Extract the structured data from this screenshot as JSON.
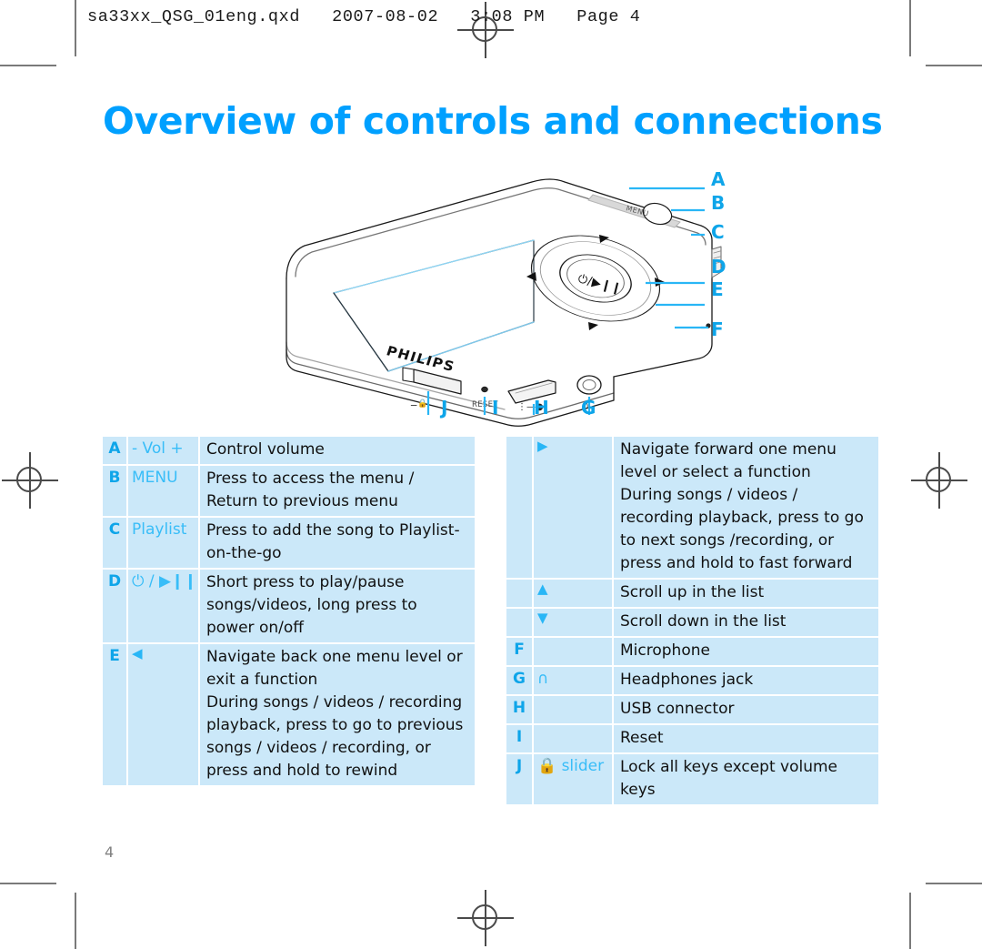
{
  "print_header": {
    "text": "sa33xx_QSG_01eng.qxd   2007-08-02   3:08 PM   Page 4"
  },
  "title": "Overview of controls and connections",
  "page_number": "4",
  "colors": {
    "accent_blue": "#00A0FF",
    "callout_blue": "#0EA5E9",
    "table_bg": "#CBE8F9",
    "control_text": "#38BDF8",
    "body_text": "#111111"
  },
  "device": {
    "brand": "PHILIPS",
    "menu_label": "MENU",
    "reset_label": "RESET",
    "center_button": "⏻/▶❙❙",
    "callouts_right": [
      "A",
      "B",
      "C",
      "D",
      "E",
      "F"
    ],
    "callouts_bottom": [
      "J",
      "I",
      "H",
      "G"
    ]
  },
  "legend_left": {
    "rows": [
      {
        "letter": "A",
        "control": "- Vol +",
        "control_kind": "text",
        "lines": [
          "Control volume"
        ]
      },
      {
        "letter": "B",
        "control": "MENU",
        "control_kind": "text",
        "lines": [
          "Press to access the menu /",
          "Return to previous menu"
        ]
      },
      {
        "letter": "C",
        "control": "Playlist",
        "control_kind": "text",
        "lines": [
          "Press to add the song to Playlist-",
          "on-the-go"
        ]
      },
      {
        "letter": "D",
        "control": "⏻ / ▶❙❙",
        "control_kind": "glyph",
        "lines": [
          "Short press to play/pause",
          "songs/videos, long press to",
          "power on/off"
        ]
      },
      {
        "letter": "E",
        "control": "◀",
        "control_kind": "triangle",
        "lines": [
          "Navigate back one menu level or",
          "exit a function",
          "During songs / videos / recording",
          "playback, press to go to previous",
          "songs / videos / recording, or",
          "press and hold to rewind"
        ]
      }
    ]
  },
  "legend_right": {
    "rows": [
      {
        "letter": "",
        "control": "▶",
        "control_kind": "triangle",
        "lines": [
          "Navigate forward one menu",
          "level or select a function",
          "During songs / videos /",
          "recording playback, press to go",
          "to next songs /recording, or",
          "press and hold to fast forward"
        ]
      },
      {
        "letter": "",
        "control": "▲",
        "control_kind": "triangle",
        "lines": [
          "Scroll up in the list"
        ]
      },
      {
        "letter": "",
        "control": "▼",
        "control_kind": "triangle",
        "lines": [
          "Scroll down in the list"
        ]
      },
      {
        "letter": "F",
        "control": "",
        "control_kind": "text",
        "lines": [
          "Microphone"
        ]
      },
      {
        "letter": "G",
        "control": "∩",
        "control_kind": "headphone",
        "lines": [
          "Headphones jack"
        ]
      },
      {
        "letter": "H",
        "control": "",
        "control_kind": "text",
        "lines": [
          "USB connector"
        ]
      },
      {
        "letter": "I",
        "control": "",
        "control_kind": "text",
        "lines": [
          "Reset"
        ]
      },
      {
        "letter": "J",
        "control": "🔒 slider",
        "control_kind": "lock",
        "lines": [
          "Lock all keys except volume",
          "keys"
        ]
      }
    ]
  }
}
